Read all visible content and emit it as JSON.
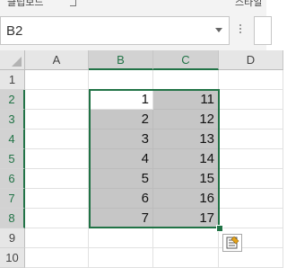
{
  "ribbon": {
    "left_label_cut": "클립보드",
    "right_label_cut": "스타일"
  },
  "formula_bar": {
    "name_box": "B2",
    "formula_value": ""
  },
  "columns": [
    "A",
    "B",
    "C",
    "D"
  ],
  "selected_columns": [
    "B",
    "C"
  ],
  "rows": [
    "1",
    "2",
    "3",
    "4",
    "5",
    "6",
    "7",
    "8",
    "9",
    "10"
  ],
  "selected_rows": [
    "2",
    "3",
    "4",
    "5",
    "6",
    "7",
    "8"
  ],
  "cells": {
    "B": [
      "",
      "1",
      "2",
      "3",
      "4",
      "5",
      "6",
      "7",
      "",
      ""
    ],
    "C": [
      "",
      "11",
      "12",
      "13",
      "14",
      "15",
      "16",
      "17",
      "",
      ""
    ]
  },
  "colors": {
    "selection": "#217346",
    "selection_fill": "#c6c6c6",
    "header_bg": "#e6e6e6"
  },
  "icons": {
    "name_box_dropdown": "chevron-down-icon",
    "quick_analysis": "quick-analysis-icon",
    "select_all": "select-all-triangle-icon"
  }
}
